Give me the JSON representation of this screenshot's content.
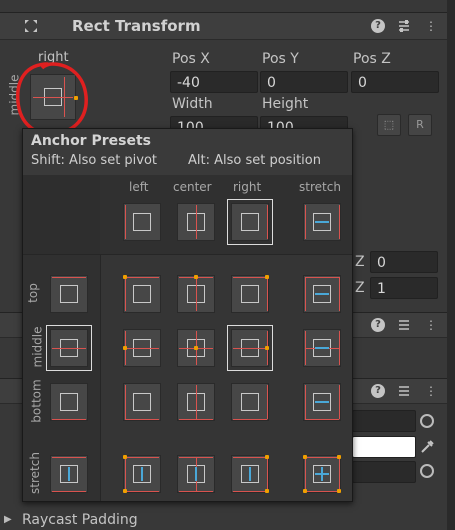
{
  "component": {
    "title": "Rect Transform",
    "anchor_h": "right",
    "anchor_v": "middle"
  },
  "fields": {
    "pos_x_label": "Pos X",
    "pos_y_label": "Pos Y",
    "pos_z_label": "Pos Z",
    "pos_x": "-40",
    "pos_y": "0",
    "pos_z": "0",
    "width_label": "Width",
    "height_label": "Height",
    "width": "100",
    "height": "100",
    "blueprint_btn": "",
    "raw_btn": "R"
  },
  "right_side": {
    "z1_label": "Z",
    "z1_value": "0",
    "z2_label": "Z",
    "z2_value": "1"
  },
  "popup": {
    "title": "Anchor Presets",
    "shift_hint": "Shift: Also set pivot",
    "alt_hint": "Alt: Also set position",
    "columns": [
      "left",
      "center",
      "right",
      "stretch"
    ],
    "rows": [
      "top",
      "middle",
      "bottom",
      "stretch"
    ]
  },
  "footer": {
    "raycast_label": "Raycast Padding"
  }
}
